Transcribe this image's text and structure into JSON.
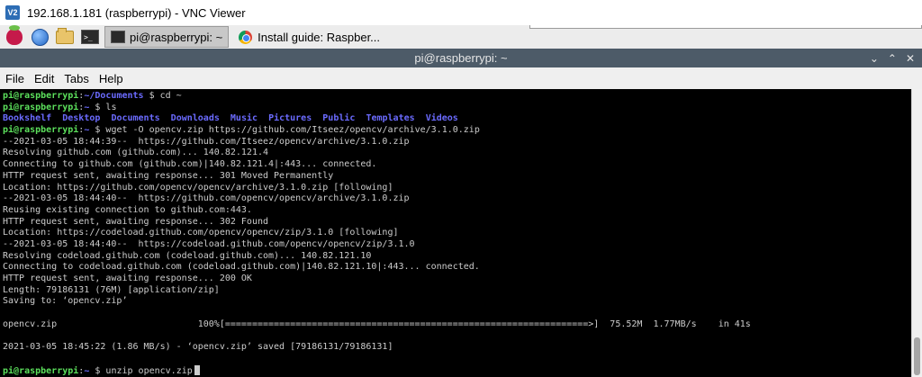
{
  "vnc": {
    "title": "192.168.1.181 (raspberrypi) - VNC Viewer",
    "logo": "V2"
  },
  "taskbar": {
    "icons": [
      "raspberry-menu-icon",
      "web-browser-icon",
      "file-manager-icon",
      "terminal-icon"
    ],
    "tasks": [
      {
        "label": "pi@raspberrypi: ~",
        "icon": "terminal-icon",
        "active": true
      },
      {
        "label": "Install guide: Raspber...",
        "icon": "chromium-icon",
        "active": false
      }
    ]
  },
  "window": {
    "title": "pi@raspberrypi: ~",
    "controls": {
      "minimize": "⌄",
      "maximize": "⌃",
      "close": "✕"
    }
  },
  "menu": [
    "File",
    "Edit",
    "Tabs",
    "Help"
  ],
  "terminal": {
    "prompt_user": "pi@raspberrypi",
    "lines": [
      {
        "path": "~/Documents",
        "cmd": "cd ~"
      },
      {
        "path": "~",
        "cmd": "ls"
      },
      {
        "dirs": [
          "Bookshelf",
          "Desktop",
          "Documents",
          "Downloads",
          "Music",
          "Pictures",
          "Public",
          "Templates",
          "Videos"
        ]
      },
      {
        "path": "~",
        "cmd": "wget -O opencv.zip https://github.com/Itseez/opencv/archive/3.1.0.zip"
      },
      {
        "text": "--2021-03-05 18:44:39--  https://github.com/Itseez/opencv/archive/3.1.0.zip"
      },
      {
        "text": "Resolving github.com (github.com)... 140.82.121.4"
      },
      {
        "text": "Connecting to github.com (github.com)|140.82.121.4|:443... connected."
      },
      {
        "text": "HTTP request sent, awaiting response... 301 Moved Permanently"
      },
      {
        "text": "Location: https://github.com/opencv/opencv/archive/3.1.0.zip [following]"
      },
      {
        "text": "--2021-03-05 18:44:40--  https://github.com/opencv/opencv/archive/3.1.0.zip"
      },
      {
        "text": "Reusing existing connection to github.com:443."
      },
      {
        "text": "HTTP request sent, awaiting response... 302 Found"
      },
      {
        "text": "Location: https://codeload.github.com/opencv/opencv/zip/3.1.0 [following]"
      },
      {
        "text": "--2021-03-05 18:44:40--  https://codeload.github.com/opencv/opencv/zip/3.1.0"
      },
      {
        "text": "Resolving codeload.github.com (codeload.github.com)... 140.82.121.10"
      },
      {
        "text": "Connecting to codeload.github.com (codeload.github.com)|140.82.121.10|:443... connected."
      },
      {
        "text": "HTTP request sent, awaiting response... 200 OK"
      },
      {
        "text": "Length: 79186131 (76M) [application/zip]"
      },
      {
        "text": "Saving to: ‘opencv.zip’"
      },
      {
        "text": ""
      },
      {
        "text": "opencv.zip                          100%[===================================================================>]  75.52M  1.77MB/s    in 41s"
      },
      {
        "text": ""
      },
      {
        "text": "2021-03-05 18:45:22 (1.86 MB/s) - ‘opencv.zip’ saved [79186131/79186131]"
      },
      {
        "text": ""
      },
      {
        "path": "~",
        "cmd": "unzip opencv.zip",
        "cursor": true
      }
    ]
  }
}
